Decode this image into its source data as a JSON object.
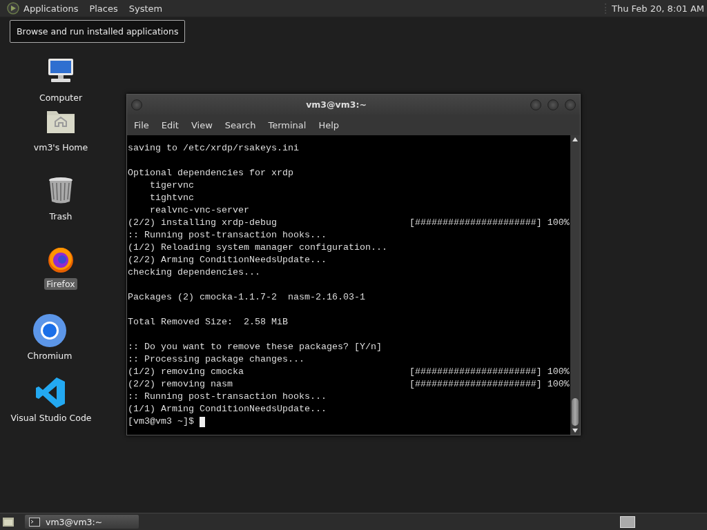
{
  "top_panel": {
    "menus": [
      "Applications",
      "Places",
      "System"
    ],
    "clock": "Thu Feb 20,  8:01 AM"
  },
  "tooltip": {
    "text": "Browse and run installed applications"
  },
  "desktop_icons": [
    {
      "kind": "computer",
      "label": "Computer",
      "selected": false
    },
    {
      "kind": "home",
      "label": "vm3's Home",
      "selected": false
    },
    {
      "kind": "trash",
      "label": "Trash",
      "selected": false
    },
    {
      "kind": "firefox",
      "label": "Firefox",
      "selected": true
    },
    {
      "kind": "chromium",
      "label": "Chromium",
      "selected": false
    },
    {
      "kind": "vscode",
      "label": "Visual Studio Code",
      "selected": false
    }
  ],
  "terminal_window": {
    "title": "vm3@vm3:~",
    "menu": [
      "File",
      "Edit",
      "View",
      "Search",
      "Terminal",
      "Help"
    ],
    "blocks": [
      [
        "saving to /etc/xrdp/rsakeys.ini"
      ],
      [
        "Optional dependencies for xrdp",
        "    tigervnc",
        "    tightvnc",
        "    realvnc-vnc-server",
        "(2/2) installing xrdp-debug                        [######################] 100%",
        ":: Running post-transaction hooks...",
        "(1/2) Reloading system manager configuration...",
        "(2/2) Arming ConditionNeedsUpdate...",
        "checking dependencies..."
      ],
      [
        "Packages (2) cmocka-1.1.7-2  nasm-2.16.03-1"
      ],
      [
        "Total Removed Size:  2.58 MiB"
      ],
      [
        ":: Do you want to remove these packages? [Y/n]",
        ":: Processing package changes...",
        "(1/2) removing cmocka                              [######################] 100%",
        "(2/2) removing nasm                                [######################] 100%",
        ":: Running post-transaction hooks...",
        "(1/1) Arming ConditionNeedsUpdate..."
      ]
    ],
    "prompt": "[vm3@vm3 ~]$"
  },
  "taskbar": {
    "tasks": [
      {
        "label": "vm3@vm3:~",
        "selected": true
      }
    ]
  }
}
